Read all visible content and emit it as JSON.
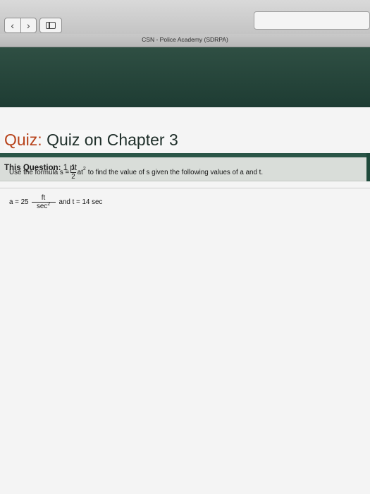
{
  "browser": {
    "back_glyph": "‹",
    "forward_glyph": "›",
    "tab_title": "CSN - Police Academy (SDRPA)"
  },
  "quiz": {
    "label": "Quiz:",
    "title": "Quiz on Chapter 3"
  },
  "question_bar": {
    "label": "This Question:",
    "points": "1 pt"
  },
  "question": {
    "intro": "Use the formula s =",
    "frac_num": "1",
    "frac_den": "2",
    "at": "at",
    "exp": "2",
    "tail": "to find the value of s given the following values of a and t.",
    "a_prefix": "a = 25",
    "unit_num": "ft",
    "unit_den": "sec",
    "unit_exp": "2",
    "t_text": "and t = 14 sec"
  },
  "icons": [
    "back-icon",
    "forward-icon",
    "sidebar-icon"
  ]
}
